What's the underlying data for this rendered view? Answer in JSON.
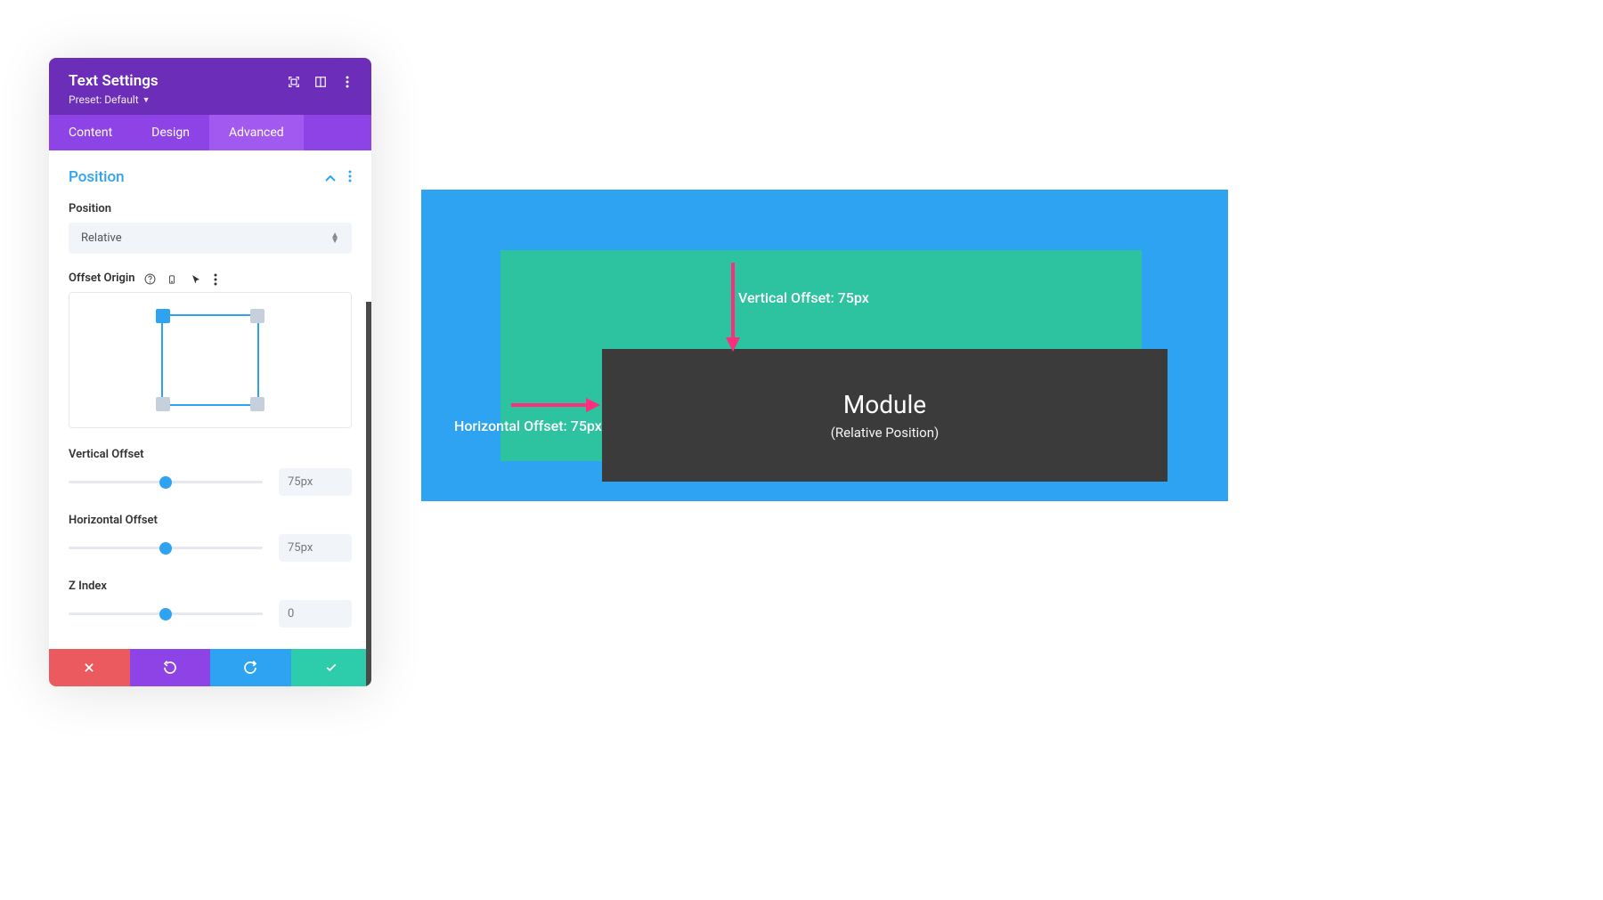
{
  "panel": {
    "title": "Text Settings",
    "preset_label": "Preset: Default"
  },
  "tabs": {
    "content": "Content",
    "design": "Design",
    "advanced": "Advanced"
  },
  "section": {
    "title": "Position"
  },
  "fields": {
    "position_label": "Position",
    "position_value": "Relative",
    "offset_origin_label": "Offset Origin",
    "vertical_offset_label": "Vertical Offset",
    "vertical_offset_value": "75px",
    "horizontal_offset_label": "Horizontal Offset",
    "horizontal_offset_value": "75px",
    "zindex_label": "Z Index",
    "zindex_value": "0"
  },
  "preview": {
    "module_title": "Module",
    "module_sub": "(Relative Position)",
    "vertical_label": "Vertical Offset: 75px",
    "horizontal_label": "Horizontal Offset: 75px"
  }
}
